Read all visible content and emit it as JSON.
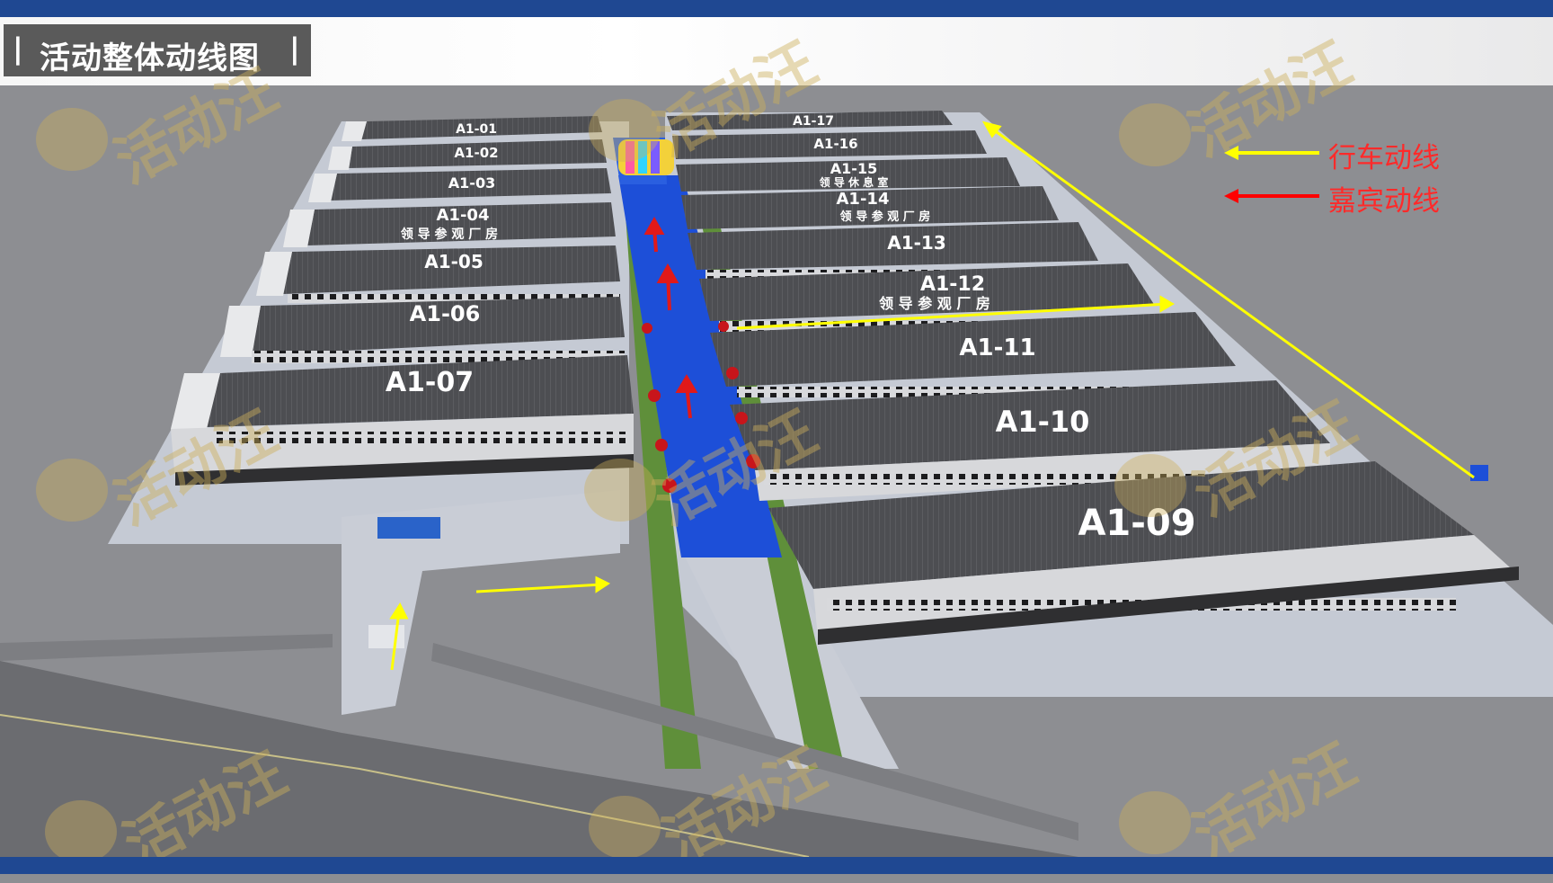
{
  "header": {
    "title": "活动整体动线图",
    "title_bar_left": "|",
    "title_bar_right": "|",
    "colors": {
      "band": "#1f4892",
      "title_bg": "#5a5a5a"
    }
  },
  "legend": {
    "items": [
      {
        "label": "行车动线",
        "color": "#ffff00",
        "text_color": "#ff2a2a"
      },
      {
        "label": "嘉宾动线",
        "color": "#ff0000",
        "text_color": "#ff2a2a"
      }
    ]
  },
  "buildings": {
    "left": [
      {
        "label": "A1-01",
        "sub": ""
      },
      {
        "label": "A1-02",
        "sub": ""
      },
      {
        "label": "A1-03",
        "sub": ""
      },
      {
        "label": "A1-04",
        "sub": "领 导 参 观 厂 房"
      },
      {
        "label": "A1-05",
        "sub": ""
      },
      {
        "label": "A1-06",
        "sub": ""
      },
      {
        "label": "A1-07",
        "sub": ""
      }
    ],
    "right": [
      {
        "label": "A1-17",
        "sub": ""
      },
      {
        "label": "A1-16",
        "sub": ""
      },
      {
        "label": "A1-15",
        "sub": "领 导 休 息 室"
      },
      {
        "label": "A1-14",
        "sub": "领 导 参 观 厂 房"
      },
      {
        "label": "A1-13",
        "sub": ""
      },
      {
        "label": "A1-12",
        "sub": "领 导 参 观 厂 房"
      },
      {
        "label": "A1-11",
        "sub": ""
      },
      {
        "label": "A1-10",
        "sub": ""
      },
      {
        "label": "A1-09",
        "sub": ""
      }
    ]
  },
  "watermark": {
    "text": "活动汪"
  },
  "colors": {
    "carpet": "#1d4fd8",
    "roof": "#4a4b4f",
    "wall": "#d9dadc",
    "ground": "#8d8e92",
    "plaza": "#c9cdd6",
    "grass": "#5f8f3a"
  }
}
